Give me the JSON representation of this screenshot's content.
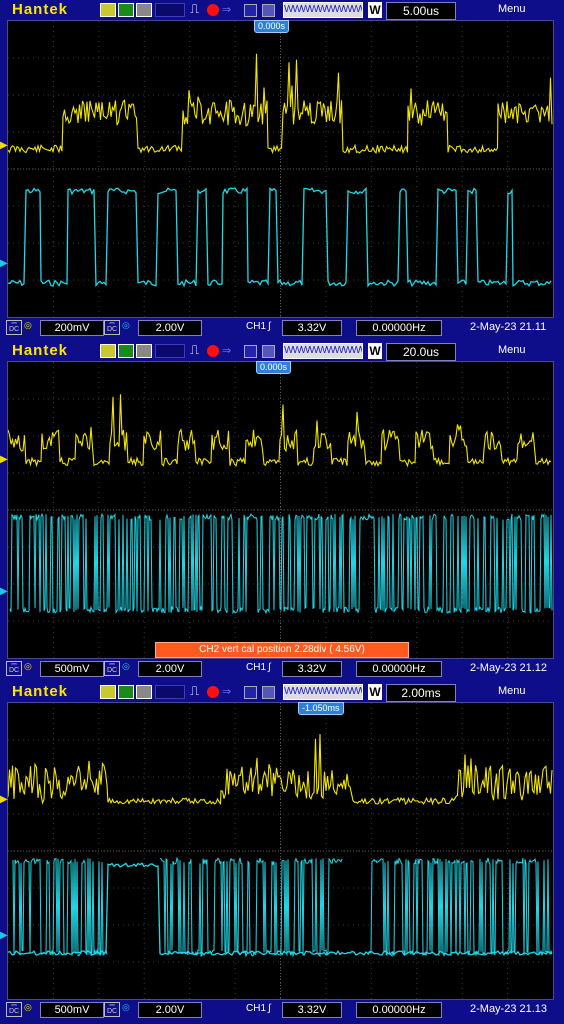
{
  "screens": [
    {
      "brand": "Hantek",
      "timebase": "5.00us",
      "menu": "Menu",
      "trigger_position": "0.000s",
      "ch1_volts_div": "200mV",
      "ch2_volts_div": "2.00V",
      "trigger_source": "CH1",
      "trigger_level": "3.32V",
      "frequency": "0.00000Hz",
      "datetime": "2-May-23 21.11",
      "note": "",
      "ch1_color": "#f2e600",
      "ch2_color": "#20d8e8"
    },
    {
      "brand": "Hantek",
      "timebase": "20.0us",
      "menu": "Menu",
      "trigger_position": "0.000s",
      "ch1_volts_div": "500mV",
      "ch2_volts_div": "2.00V",
      "trigger_source": "CH1",
      "trigger_level": "3.32V",
      "frequency": "0.00000Hz",
      "datetime": "2-May-23 21.12",
      "note": "CH2 vert cal position 2.28div ( 4.56V)",
      "ch1_color": "#f2e600",
      "ch2_color": "#20d8e8"
    },
    {
      "brand": "Hantek",
      "timebase": "2.00ms",
      "menu": "Menu",
      "trigger_position": "-1.050ms",
      "ch1_volts_div": "500mV",
      "ch2_volts_div": "2.00V",
      "trigger_source": "CH1",
      "trigger_level": "3.32V",
      "frequency": "0.00000Hz",
      "datetime": "2-May-23 21.13",
      "note": "",
      "ch1_color": "#f2e600",
      "ch2_color": "#20d8e8"
    }
  ],
  "coupling_label": "DC",
  "w_label": "W",
  "level_marker_ch1": "1",
  "level_marker_ch2": "2"
}
